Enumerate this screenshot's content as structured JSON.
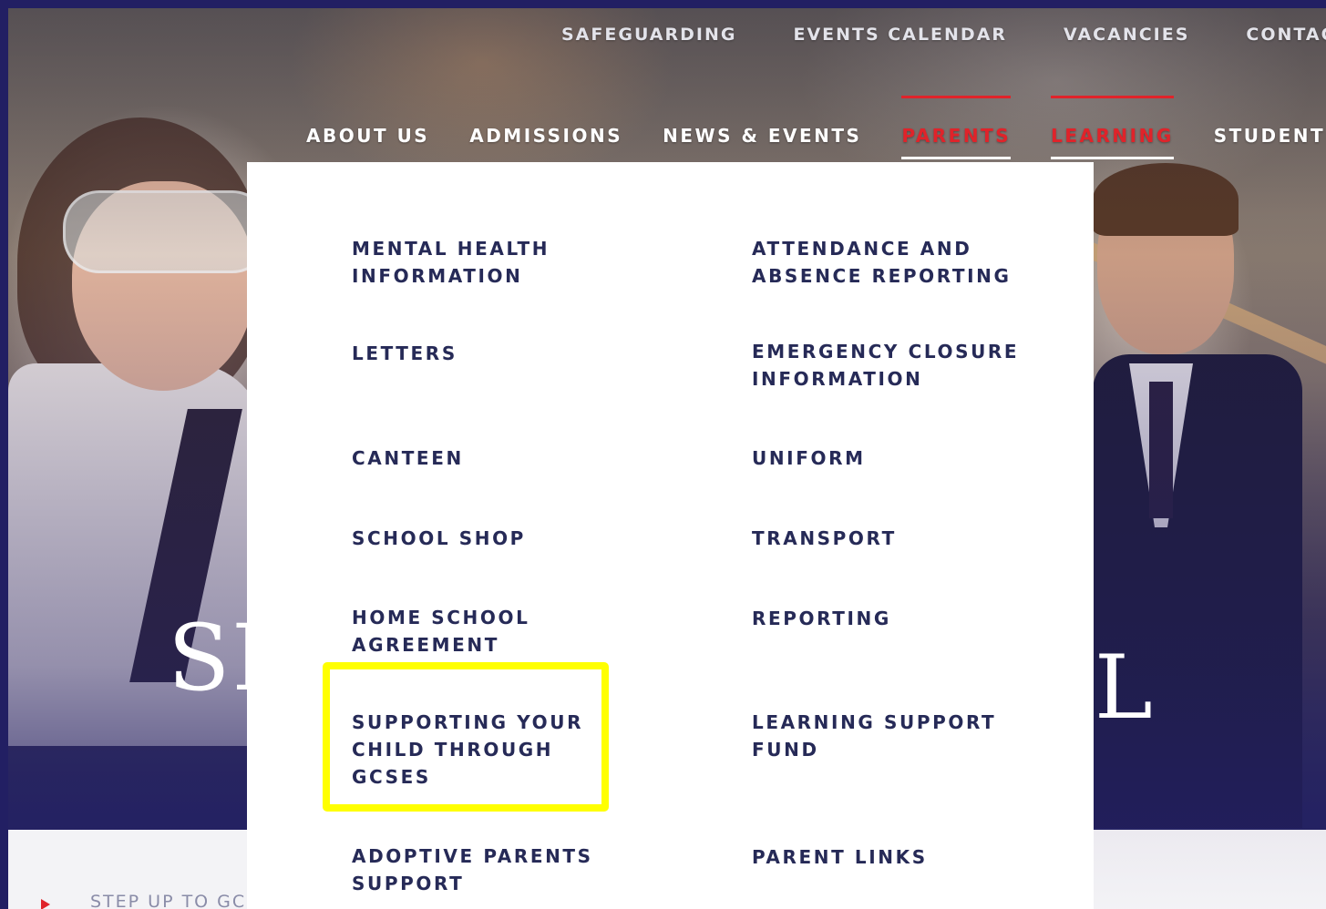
{
  "top_nav": {
    "items": [
      "SAFEGUARDING",
      "EVENTS CALENDAR",
      "VACANCIES",
      "CONTAC"
    ]
  },
  "main_nav": {
    "items": [
      {
        "label": "ABOUT US",
        "active": false
      },
      {
        "label": "ADMISSIONS",
        "active": false
      },
      {
        "label": "NEWS & EVENTS",
        "active": false
      },
      {
        "label": "PARENTS",
        "active": true
      },
      {
        "label": "LEARNING",
        "active": true
      },
      {
        "label": "STUDENT",
        "active": false
      }
    ]
  },
  "hero": {
    "title_left": "SM",
    "title_right": "L"
  },
  "dropdown": {
    "col1": [
      "MENTAL HEALTH INFORMATION",
      "LETTERS",
      "CANTEEN",
      "SCHOOL SHOP",
      "HOME SCHOOL AGREEMENT",
      "SUPPORTING YOUR CHILD THROUGH GCSES",
      "ADOPTIVE PARENTS SUPPORT"
    ],
    "col2": [
      "ATTENDANCE AND ABSENCE REPORTING",
      "EMERGENCY CLOSURE INFORMATION",
      "UNIFORM",
      "TRANSPORT",
      "REPORTING",
      "LEARNING SUPPORT FUND",
      "PARENT LINKS"
    ],
    "highlighted_item": "SUPPORTING YOUR CHILD THROUGH GCSES",
    "highlight_color": "#ffff00"
  },
  "bottom": {
    "link_text": "STEP UP TO GC"
  },
  "colors": {
    "accent_red": "#e0232a",
    "menu_text": "#262a57",
    "frame_bg": "#221f63"
  }
}
